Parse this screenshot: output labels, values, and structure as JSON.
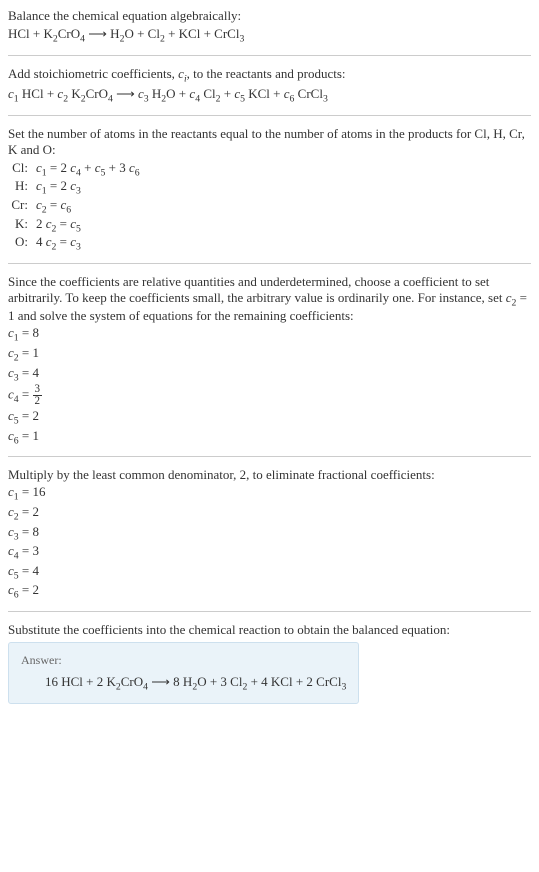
{
  "section1": {
    "title": "Balance the chemical equation algebraically:",
    "equation": "HCl + K₂CrO₄ ⟶ H₂O + Cl₂ + KCl + CrCl₃"
  },
  "section2": {
    "title_part1": "Add stoichiometric coefficients, ",
    "title_var": "c",
    "title_sub": "i",
    "title_part2": ", to the reactants and products:",
    "equation": "c₁ HCl + c₂ K₂CrO₄ ⟶ c₃ H₂O + c₄ Cl₂ + c₅ KCl + c₆ CrCl₃"
  },
  "section3": {
    "title": "Set the number of atoms in the reactants equal to the number of atoms in the products for Cl, H, Cr, K and O:",
    "atoms": [
      {
        "label": "Cl:",
        "eq": "c₁ = 2 c₄ + c₅ + 3 c₆"
      },
      {
        "label": "H:",
        "eq": "c₁ = 2 c₃"
      },
      {
        "label": "Cr:",
        "eq": "c₂ = c₆"
      },
      {
        "label": "K:",
        "eq": "2 c₂ = c₅"
      },
      {
        "label": "O:",
        "eq": "4 c₂ = c₃"
      }
    ]
  },
  "section4": {
    "title": "Since the coefficients are relative quantities and underdetermined, choose a coefficient to set arbitrarily. To keep the coefficients small, the arbitrary value is ordinarily one. For instance, set c₂ = 1 and solve the system of equations for the remaining coefficients:",
    "coeffs": [
      "c₁ = 8",
      "c₂ = 1",
      "c₃ = 4"
    ],
    "frac_line": {
      "lhs": "c₄ = ",
      "num": "3",
      "den": "2"
    },
    "coeffs2": [
      "c₅ = 2",
      "c₆ = 1"
    ]
  },
  "section5": {
    "title": "Multiply by the least common denominator, 2, to eliminate fractional coefficients:",
    "coeffs": [
      "c₁ = 16",
      "c₂ = 2",
      "c₃ = 8",
      "c₄ = 3",
      "c₅ = 4",
      "c₆ = 2"
    ]
  },
  "section6": {
    "title": "Substitute the coefficients into the chemical reaction to obtain the balanced equation:",
    "answer_label": "Answer:",
    "answer": "16 HCl + 2 K₂CrO₄ ⟶ 8 H₂O + 3 Cl₂ + 4 KCl + 2 CrCl₃"
  }
}
